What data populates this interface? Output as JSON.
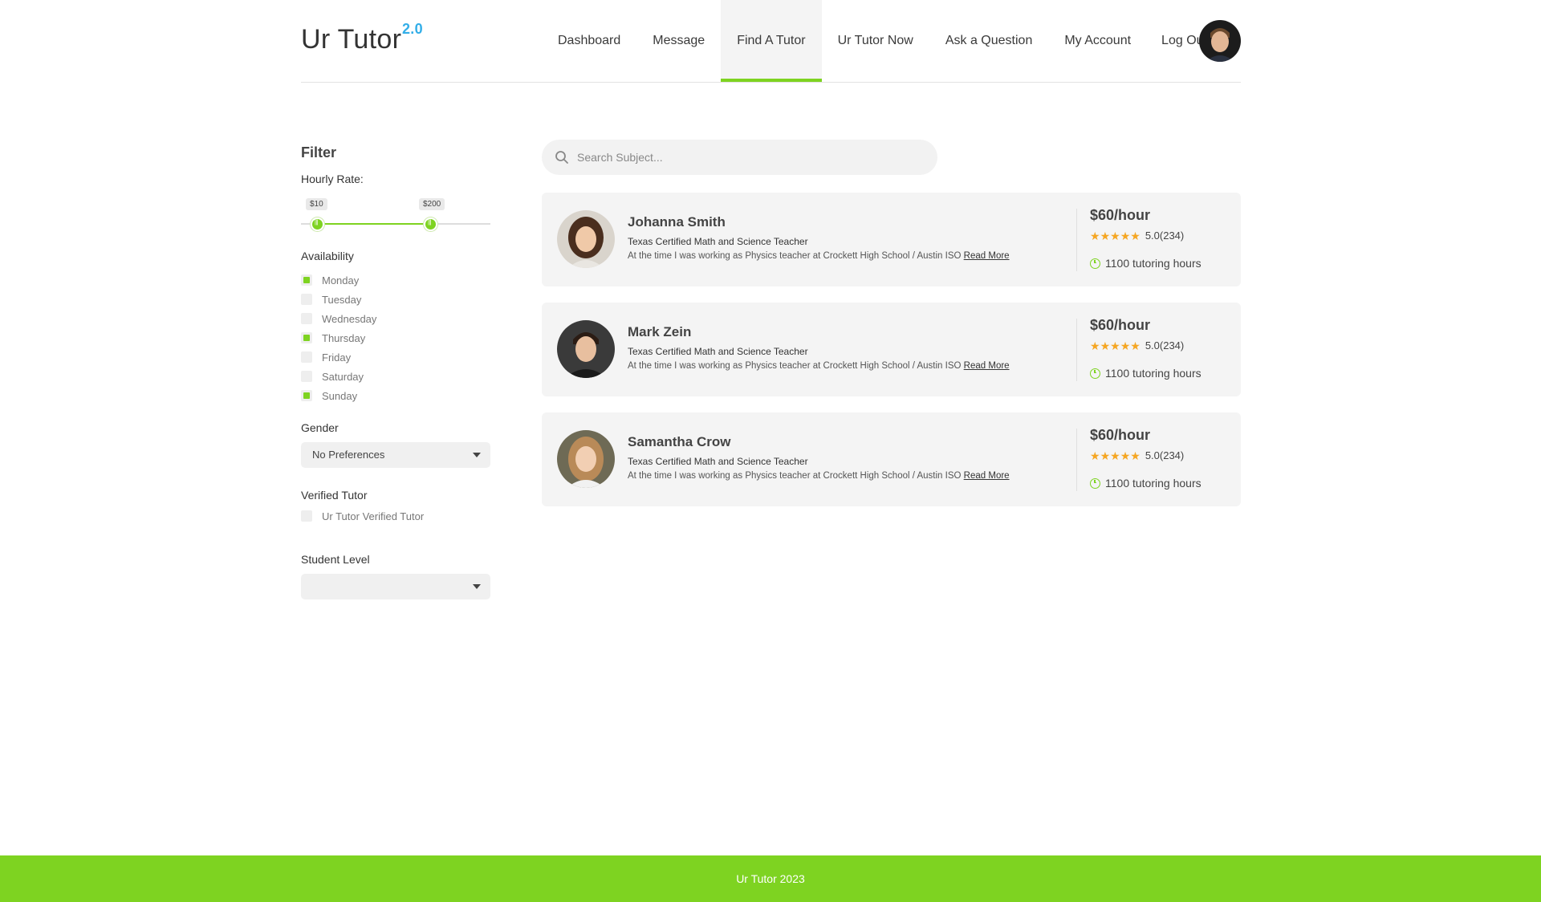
{
  "logo": {
    "text": "Ur Tutor",
    "version": "2.0"
  },
  "nav": {
    "items": [
      "Dashboard",
      "Message",
      "Find A Tutor",
      "Ur Tutor Now",
      "Ask a Question",
      "My Account"
    ],
    "active": "Find A Tutor",
    "logout": "Log Out"
  },
  "filter": {
    "title": "Filter",
    "hourly_rate": {
      "label": "Hourly Rate:",
      "min_label": "$10",
      "max_label": "$200"
    },
    "availability": {
      "label": "Availability",
      "days": [
        {
          "label": "Monday",
          "checked": true
        },
        {
          "label": "Tuesday",
          "checked": false
        },
        {
          "label": "Wednesday",
          "checked": false
        },
        {
          "label": "Thursday",
          "checked": true
        },
        {
          "label": "Friday",
          "checked": false
        },
        {
          "label": "Saturday",
          "checked": false
        },
        {
          "label": "Sunday",
          "checked": true
        }
      ]
    },
    "gender": {
      "label": "Gender",
      "value": "No Preferences"
    },
    "verified": {
      "label": "Verified Tutor",
      "option": "Ur Tutor Verified Tutor",
      "checked": false
    },
    "student_level": {
      "label": "Student Level",
      "value": ""
    }
  },
  "search": {
    "placeholder": "Search Subject..."
  },
  "tutors": [
    {
      "name": "Johanna Smith",
      "subtitle": "Texas Certified Math and Science Teacher",
      "description": "At the time I was working as Physics teacher at Crockett High School / Austin ISO",
      "read_more": "Read More",
      "price": "$60/hour",
      "rating": "5.0(234)",
      "hours": "1100 tutoring hours"
    },
    {
      "name": "Mark Zein",
      "subtitle": "Texas Certified Math and Science Teacher",
      "description": "At the time I was working as Physics teacher at Crockett High School / Austin ISO",
      "read_more": "Read More",
      "price": "$60/hour",
      "rating": "5.0(234)",
      "hours": "1100 tutoring hours"
    },
    {
      "name": "Samantha Crow",
      "subtitle": "Texas Certified Math and Science Teacher",
      "description": "At the time I was working as Physics teacher at Crockett High School / Austin ISO",
      "read_more": "Read More",
      "price": "$60/hour",
      "rating": "5.0(234)",
      "hours": "1100 tutoring hours"
    }
  ],
  "footer": {
    "text": "Ur Tutor 2023"
  },
  "colors": {
    "accent": "#7ed321",
    "logo_version": "#32aee8",
    "star": "#f5a623"
  }
}
